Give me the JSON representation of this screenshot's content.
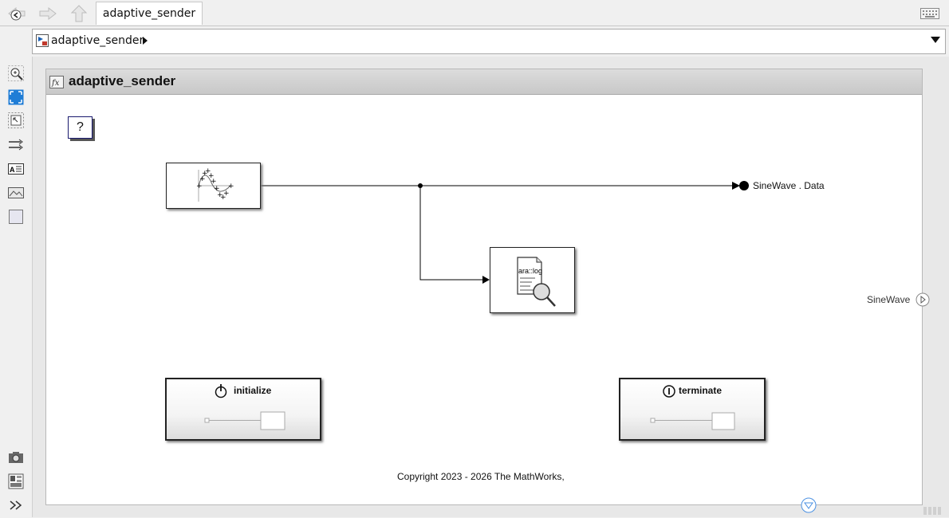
{
  "tabs": [
    {
      "label": "adaptive_sender"
    }
  ],
  "nav": {
    "back_icon": "back-arrow-icon",
    "forward_icon": "forward-arrow-icon",
    "up_icon": "up-arrow-icon"
  },
  "address": {
    "model_name": "adaptive_sender"
  },
  "left_toolbar": [
    {
      "name": "zoom-icon"
    },
    {
      "name": "fit-to-view-icon"
    },
    {
      "name": "zoom-to-selection-icon"
    },
    {
      "name": "signal-routing-icon"
    },
    {
      "name": "annotation-icon"
    },
    {
      "name": "image-icon"
    },
    {
      "name": "area-icon"
    },
    {
      "name": "camera-icon"
    },
    {
      "name": "property-inspector-icon"
    },
    {
      "name": "expand-icon"
    }
  ],
  "model": {
    "title": "adaptive_sender",
    "help_label": "?",
    "blocks": {
      "sine_wave": {
        "icon": "sine-wave-icon"
      },
      "logger": {
        "label": "ara::log"
      },
      "initialize": {
        "label": "initialize"
      },
      "terminate": {
        "label": "terminate"
      }
    },
    "signal_label": "SineWave . Data",
    "outport_label": "SineWave",
    "copyright": "Copyright 2023 - 2026 The MathWorks,"
  },
  "colors": {
    "signal_line": "#000000",
    "block_border": "#222222",
    "title_bar": "#d0d0d0",
    "help_border": "#1a1a6e"
  }
}
